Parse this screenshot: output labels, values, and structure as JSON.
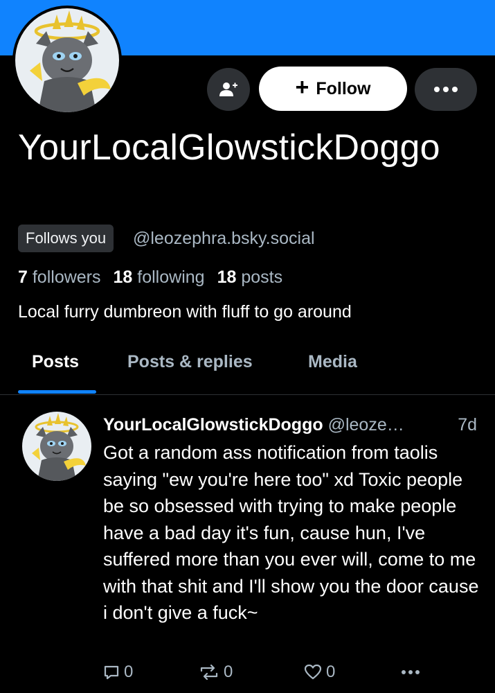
{
  "profile": {
    "display_name": "YourLocalGlowstickDoggo",
    "follows_you_label": "Follows you",
    "handle": "@leozephra.bsky.social",
    "followers_count": "7",
    "followers_label": "followers",
    "following_count": "18",
    "following_label": "following",
    "posts_count": "18",
    "posts_label": "posts",
    "bio": "Local furry dumbreon with fluff to go around"
  },
  "actions": {
    "follow_label": "Follow",
    "add_user_icon": "add-user-icon",
    "more_icon": "ellipsis-icon"
  },
  "tabs": [
    {
      "label": "Posts",
      "active": true
    },
    {
      "label": "Posts & replies",
      "active": false
    },
    {
      "label": "Media",
      "active": false
    }
  ],
  "post": {
    "author": "YourLocalGlowstickDoggo",
    "handle": "@leoze…",
    "time": "7d",
    "text": "Got a random ass notification from taolis saying \"ew you're here too\" xd Toxic people be so obsessed with trying to make people have a bad day it's fun, cause hun, I've suffered more than you ever will, come to me with that shit and I'll show you the door cause i don't give a fuck~",
    "reply_count": "0",
    "repost_count": "0",
    "like_count": "0"
  },
  "colors": {
    "banner": "#1083fe",
    "background": "#000000",
    "muted_text": "#aab8c4",
    "button_dark": "#2e3135"
  }
}
